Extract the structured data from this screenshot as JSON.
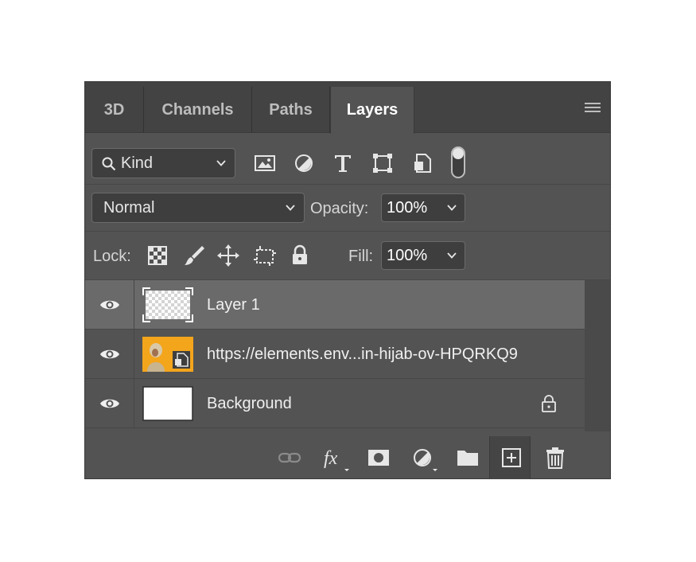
{
  "tabs": [
    {
      "label": "3D",
      "active": false
    },
    {
      "label": "Channels",
      "active": false
    },
    {
      "label": "Paths",
      "active": false
    },
    {
      "label": "Layers",
      "active": true
    }
  ],
  "filter": {
    "kind_label": "Kind",
    "filter_icons": [
      "image-filter-icon",
      "adjustment-filter-icon",
      "type-filter-icon",
      "shape-filter-icon",
      "smart-object-filter-icon",
      "filter-toggle-switch"
    ]
  },
  "blend": {
    "mode": "Normal",
    "opacity_label": "Opacity:",
    "opacity_value": "100%"
  },
  "lock": {
    "label": "Lock:",
    "icons": [
      "lock-transparent-pixels-icon",
      "lock-image-pixels-icon",
      "lock-position-icon",
      "lock-artboard-icon",
      "lock-all-icon"
    ],
    "fill_label": "Fill:",
    "fill_value": "100%"
  },
  "layers": [
    {
      "name": "Layer 1",
      "selected": true,
      "thumb": "transparent"
    },
    {
      "name": "https://elements.env...in-hijab-ov-HPQRKQ9",
      "selected": false,
      "thumb": "smart-object"
    },
    {
      "name": "Background",
      "selected": false,
      "thumb": "white",
      "locked": true
    }
  ],
  "footer_icons": [
    "link-layers-icon",
    "fx-icon",
    "mask-icon",
    "adjustment-layer-icon",
    "group-folder-icon",
    "new-layer-icon",
    "trash-icon"
  ],
  "colors": {
    "panel_bg": "#535353",
    "tab_bar_bg": "#434343",
    "selected_layer": "#6a6a6a",
    "thumb_orange": "#f3a51c"
  }
}
